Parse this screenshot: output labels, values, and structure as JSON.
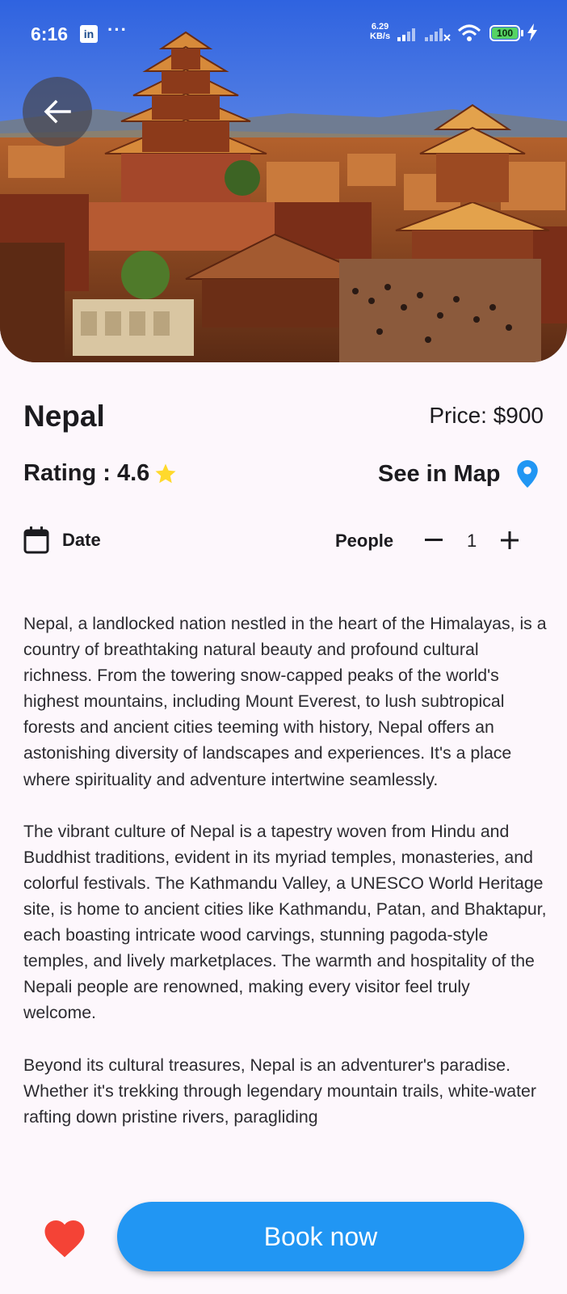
{
  "status_bar": {
    "time": "6:16",
    "linkedin_icon": "in",
    "more": "···",
    "speed_value": "6.29",
    "speed_unit": "KB/s",
    "battery": "100"
  },
  "hero": {
    "image": "nepal-pagoda-temples-photo"
  },
  "destination": {
    "name": "Nepal",
    "price": "Price: $900",
    "rating": "Rating : 4.6",
    "map_label": "See in Map"
  },
  "booking": {
    "date_label": "Date",
    "people_label": "People",
    "quantity": "1"
  },
  "description": "Nepal, a landlocked nation nestled in the heart of the Himalayas, is a country of breathtaking natural beauty and profound cultural richness. From the towering snow-capped peaks of the world's highest mountains, including Mount Everest, to lush subtropical forests and ancient cities teeming with history, Nepal offers an astonishing diversity of landscapes and experiences. It's a place where spirituality and adventure intertwine seamlessly.\n\nThe vibrant culture of Nepal is a tapestry woven from Hindu and Buddhist traditions, evident in its myriad temples, monasteries, and colorful festivals. The Kathmandu Valley, a UNESCO World Heritage site, is home to ancient cities like Kathmandu, Patan, and Bhaktapur, each boasting intricate wood carvings, stunning pagoda-style temples, and lively marketplaces. The warmth and hospitality of the Nepali people are renowned, making every visitor feel truly welcome.\n\nBeyond its cultural treasures, Nepal is an adventurer's paradise. Whether it's trekking through legendary mountain trails, white-water rafting down pristine rivers, paragliding",
  "actions": {
    "book_label": "Book now"
  },
  "colors": {
    "accent": "#2196f3",
    "heart": "#f44336",
    "star": "#ffd92c",
    "background": "#fdf7fc"
  },
  "icons": [
    "back-arrow-icon",
    "star-icon",
    "map-pin-icon",
    "calendar-icon",
    "minus-icon",
    "plus-icon",
    "heart-icon"
  ]
}
